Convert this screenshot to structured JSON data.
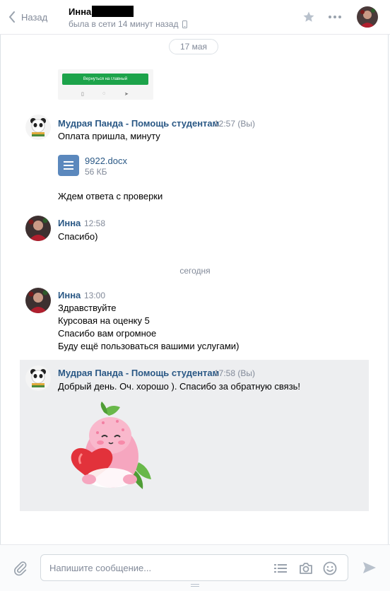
{
  "header": {
    "back_label": "Назад",
    "peer_name": "Инна",
    "peer_status": "была в сети 14 минут назад"
  },
  "date_pill": "17 мая",
  "screenshot_preview": {
    "button_label": "Вернуться на главный"
  },
  "messages": [
    {
      "author": "Мудрая Панда - Помощь студентам",
      "time": "12:57",
      "tag": "(Вы)",
      "lines": [
        "Оплата пришла, минуту"
      ],
      "attachment": {
        "name": "9922.docx",
        "size": "56 КБ"
      },
      "lines_after": [
        "Ждем ответа с проверки"
      ]
    },
    {
      "author": "Инна",
      "time": "12:58",
      "lines": [
        "Спасибо)"
      ]
    },
    {
      "author": "Инна",
      "time": "13:00",
      "lines": [
        "Здравствуйте",
        "Курсовая на оценку 5",
        "Спасибо вам огромное",
        "Буду ещё пользоваться вашими услугами)"
      ]
    },
    {
      "author": "Мудрая Панда - Помощь студентам",
      "time": "17:58",
      "tag": "(Вы)",
      "lines": [
        "Добрый день. Оч. хорошо ). Спасибо за обратную связь!"
      ]
    }
  ],
  "day_separator": "сегодня",
  "composer": {
    "placeholder": "Напишите сообщение..."
  },
  "colors": {
    "link": "#2a5885",
    "muted": "#828a99",
    "highlight": "#edeef0",
    "doc": "#5b88bd"
  }
}
